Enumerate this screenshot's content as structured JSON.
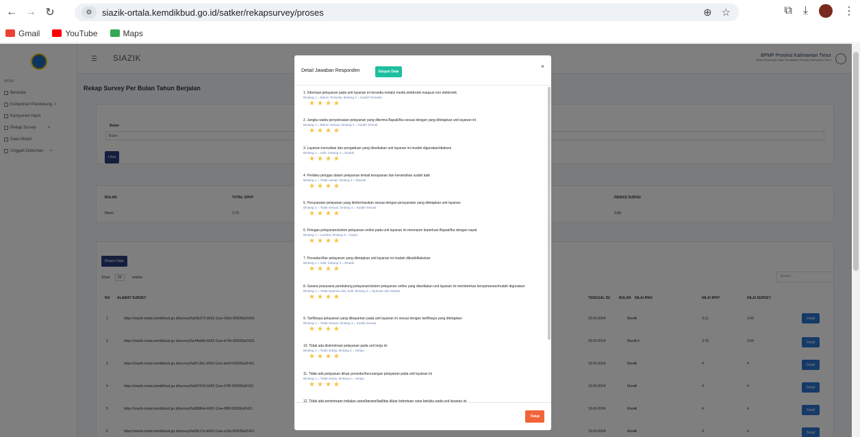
{
  "browser": {
    "url": "siazik-ortala.kemdikbud.go.id/satker/rekapsurvey/proses",
    "bookmarks": [
      "Gmail",
      "YouTube",
      "Maps"
    ]
  },
  "app": {
    "brand": "SIAZIK",
    "org_name": "BPMP Provinsi Kalimantan Timur",
    "org_sub": "Balai Penjaminan Mutu Pendidikan Provinsi Kalimantan Timur"
  },
  "sidebar": {
    "section": "MENU",
    "items": [
      {
        "label": "Beranda",
        "chevron": ""
      },
      {
        "label": "Komponen Pendukung",
        "chevron": ">"
      },
      {
        "label": "Komponen Hasil",
        "chevron": ""
      },
      {
        "label": "Rekap Survey",
        "chevron": ">"
      },
      {
        "label": "Data Histori",
        "chevron": ""
      },
      {
        "label": "Unggah Dokumen",
        "chevron": ">"
      }
    ]
  },
  "main": {
    "title": "Rekap Survey Per Bulan Tahun Berjalan",
    "filter": {
      "label": "Bulan",
      "value": "Bulan",
      "button": "Lihat"
    },
    "summary": {
      "headers": [
        "BULAN",
        "TOTAL SPKP",
        "INDEKS SURVEI"
      ],
      "values": [
        "Maret",
        "3.79",
        "3.88"
      ]
    },
    "list": {
      "export": "Ekspor Data",
      "show": "Show",
      "entries_value": "20",
      "entries": "entries",
      "search_placeholder": "Search...",
      "headers": [
        "NO",
        "ALAMAT SURVEY",
        "TANGGAL ISI",
        "BULAN",
        "NILAI IPAK",
        "NILAI IPKP",
        "NILAI SURVEY"
      ],
      "rows": [
        {
          "no": "1",
          "url": "https://siazik-ortala.kemdikbud.go.id/survey/6a59b372-b693-11ee-93eb-005056af1431",
          "date": "20-03-2024",
          "month": "Maret",
          "ipak": "4",
          "ipkp": "3.11",
          "survey": "3.43"
        },
        {
          "no": "2",
          "url": "https://siazik-ortala.kemdikbud.go.id/survey/6a44bd96-b693-11ee-b74b-005056af1431",
          "date": "20-03-2024",
          "month": "Maret",
          "ipak": "3.4",
          "ipkp": "3.78",
          "survey": "3.64"
        },
        {
          "no": "3",
          "url": "https://siazik-ortala.kemdikbud.go.id/survey/6a87c3dc-b693-11ee-ae03-005056af1431",
          "date": "19-03-2024",
          "month": "Maret",
          "ipak": "4",
          "ipkp": "4",
          "survey": "4"
        },
        {
          "no": "4",
          "url": "https://siazik-ortala.kemdikbud.go.id/survey/6a597010-b693-11ee-97f8-005056af1431",
          "date": "19-03-2024",
          "month": "Maret",
          "ipak": "4",
          "ipkp": "4",
          "survey": "4"
        },
        {
          "no": "5",
          "url": "https://siazik-ortala.kemdikbud.go.id/survey/6a58884e-b693-11ee-88ff-005056af1431",
          "date": "19-03-2024",
          "month": "Maret",
          "ipak": "4",
          "ipkp": "4",
          "survey": "4"
        },
        {
          "no": "6",
          "url": "https://siazik-ortala.kemdikbud.go.id/survey/6a58c17e-b693-11ee-a13b-005056af1431",
          "date": "19-03-2024",
          "month": "Maret",
          "ipak": "4",
          "ipkp": "4",
          "survey": "4"
        }
      ],
      "detail": "Detail"
    }
  },
  "modal": {
    "title": "Detail Jawaban Responden",
    "export": "Ekspor Data",
    "close_x": "×",
    "close_button": "Tutup",
    "questions": [
      {
        "text": "1. Informasi pelayanan pada unit layanan ini tersedia melalui media elektronik maupun non elektronik",
        "hint": "Bintang 1 = Belum Tersedia, bintang 4 = Sudah Tersedia",
        "stars": 4
      },
      {
        "text": "2. Jangka waktu penyelesaian pelayanan yang diterima Bapak/Ibu sesuai dengan yang ditetapkan unit layanan ini",
        "hint": "Bintang 1 = Belum Sesuai, bintang 4 = Sudah Sesuai",
        "stars": 4
      },
      {
        "text": "3. Layanan konsultasi dan pengaduan yang disediakan unit layanan ini mudah digunakan/diakses",
        "hint": "Bintang 1 = Sulit, bintang 4 = Mudah",
        "stars": 4
      },
      {
        "text": "4. Perilaku petugas dalam pelayanan terkait kesopanan dan keramahan sudah baik",
        "hint": "Bintang 1 = Tidak ramah, bintang 4 = Ramah",
        "stars": 4
      },
      {
        "text": "5. Persyaratan pelayanan yang diinformasikan sesuai dengan persyaratan yang ditetapkan unit layanan",
        "hint": "Bintang 1 = Tidak Sesuai, bintang 4 = Sudah Sesuai",
        "stars": 4
      },
      {
        "text": "6. Petugas pelayanan/sistem pelayanan online pada unit layanan ini merespon keperluan Bapak/Ibu dengan cepat",
        "hint": "Bintang 1 = Lambat, bintang 4 = Cepat",
        "stars": 4
      },
      {
        "text": "7. Prosedur/Alur pelayanan yang ditetapkan unit layanan ini mudah diikuti/dilakukan",
        "hint": "Bintang 1 = Sulit, bintang 4 = Mudah",
        "stars": 4
      },
      {
        "text": "8. Sarana prasarana pendukung pelayanan/sistem pelayanan online yang disediakan unit layanan ini memberikan kenyamanan/mudah digunakan",
        "hint": "Bintang 1 = Tidak Nyaman dan Sulit, bintang 4 = Nyaman dan Mudah",
        "stars": 4
      },
      {
        "text": "9. Tarif/biaya pelayanan yang dibayarkan pada unit layanan ini sesuai dengan tarif/biaya yang ditetapkan",
        "hint": "Bintang 1 = Tidak Sesuai, bintang 4 = Sudah Sesuai",
        "stars": 4
      },
      {
        "text": "10. Tidak ada diskriminasi pelayanan pada unit kerja ini",
        "hint": "Bintang 1 = Tidak setuju, bintang 4 = Setuju",
        "stars": 4
      },
      {
        "text": "11. Tidak ada pelayanan diluar prosedur/kecurangan pelayanan pada unit layanan ini",
        "hint": "Bintang 1 = Tidak setuju, bintang 4 = Setuju",
        "stars": 4
      },
      {
        "text": "12. Tidak ada penerimaan imbalan uang/barang/fasilitas diluar ketentuan yang berlaku pada unit layanan ini",
        "hint": "",
        "stars": 0
      }
    ]
  },
  "colors": {
    "star": "#f6c343",
    "export_green": "#1ebf9e",
    "close_orange": "#f0643a",
    "navy": "#2a3e7a",
    "detail_blue": "#2d75d1"
  }
}
